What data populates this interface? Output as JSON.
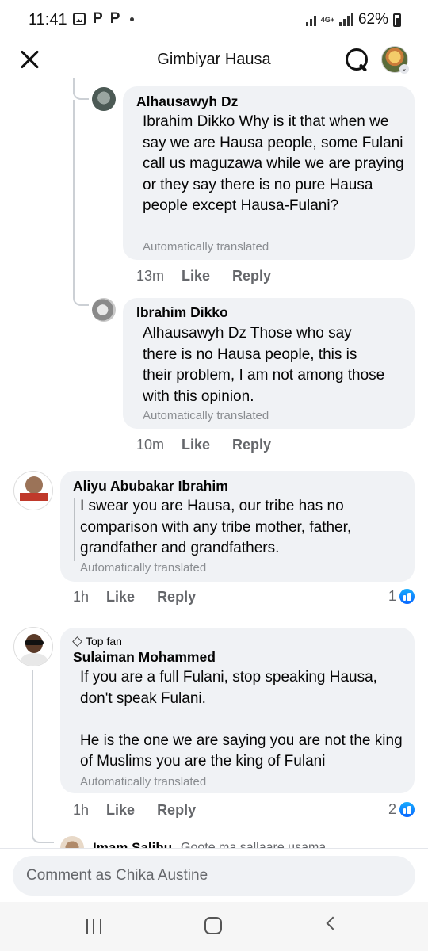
{
  "status_bar": {
    "time": "11:41",
    "notif_p1": "P",
    "notif_p2": "P",
    "network": "4G+",
    "battery": "62%"
  },
  "header": {
    "title": "Gimbiyar Hausa"
  },
  "comments": [
    {
      "author": "Alhausawyh Dz",
      "text": "Ibrahim Dikko Why is it that when we say we are Hausa people, some Fulani call us maguzawa while we are praying or they say there is no pure Hausa people except Hausa-Fulani?",
      "translated_note": "Automatically translated",
      "time": "13m",
      "like_label": "Like",
      "reply_label": "Reply"
    },
    {
      "author": "Ibrahim Dikko",
      "text": "Alhausawyh Dz Those who say there is no Hausa people, this is their problem, I am not among those with this opinion.",
      "translated_note": "Automatically translated",
      "time": "10m",
      "like_label": "Like",
      "reply_label": "Reply"
    },
    {
      "author": "Aliyu Abubakar Ibrahim",
      "text": "I swear you are Hausa, our tribe has no comparison with any tribe mother, father, grandfather and grandfathers.",
      "translated_note": "Automatically translated",
      "time": "1h",
      "like_label": "Like",
      "reply_label": "Reply",
      "reactions": "1"
    },
    {
      "badge": "Top fan",
      "author": "Sulaiman Mohammed",
      "text_p1": "If you are a full Fulani, stop speaking Hausa, don't speak Fulani.",
      "text_p2": "He is the one we are saying you are not the king of Muslims you are the king of Fulani",
      "translated_note": "Automatically translated",
      "time": "1h",
      "like_label": "Like",
      "reply_label": "Reply",
      "reactions": "2"
    },
    {
      "author": "Imam Salihu",
      "text": "Goote ma sallaare usama"
    }
  ],
  "composer": {
    "placeholder": "Comment as Chika Austine"
  },
  "icons": {
    "close": "close-icon",
    "search": "search-icon",
    "like_reaction": "like-reaction-icon",
    "top_fan": "diamond-icon"
  },
  "colors": {
    "bubble": "#f0f2f5",
    "meta_text": "#65676b",
    "translated": "#8a8d91",
    "like_blue": "#0866ff"
  }
}
